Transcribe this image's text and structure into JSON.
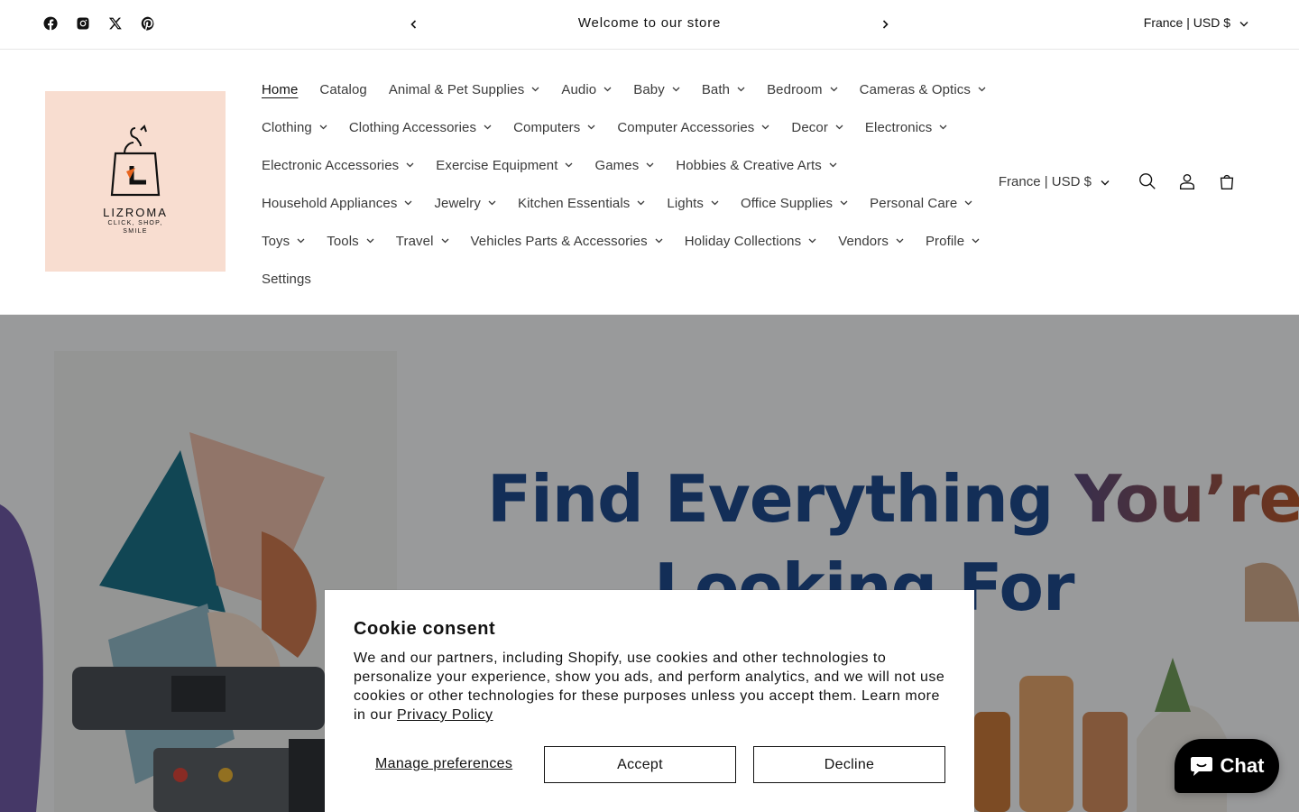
{
  "announcement": {
    "text": "Welcome to our store",
    "socials": [
      "facebook",
      "instagram",
      "x",
      "pinterest"
    ],
    "country_selector": "France | USD $"
  },
  "logo": {
    "name": "LIZROMA",
    "tagline": "CLICK, SHOP, SMILE"
  },
  "nav": {
    "rows": [
      [
        {
          "label": "Home",
          "dropdown": false,
          "active": true
        },
        {
          "label": "Catalog",
          "dropdown": false
        },
        {
          "label": "Animal & Pet Supplies",
          "dropdown": true
        },
        {
          "label": "Audio",
          "dropdown": true
        },
        {
          "label": "Baby",
          "dropdown": true
        },
        {
          "label": "Bath",
          "dropdown": true
        },
        {
          "label": "Bedroom",
          "dropdown": true
        },
        {
          "label": "Cameras & Optics",
          "dropdown": true
        }
      ],
      [
        {
          "label": "Clothing",
          "dropdown": true
        },
        {
          "label": "Clothing Accessories",
          "dropdown": true
        },
        {
          "label": "Computers",
          "dropdown": true
        },
        {
          "label": "Computer Accessories",
          "dropdown": true
        },
        {
          "label": "Decor",
          "dropdown": true
        },
        {
          "label": "Electronics",
          "dropdown": true
        }
      ],
      [
        {
          "label": "Electronic Accessories",
          "dropdown": true
        },
        {
          "label": "Exercise Equipment",
          "dropdown": true
        },
        {
          "label": "Games",
          "dropdown": true
        },
        {
          "label": "Hobbies & Creative Arts",
          "dropdown": true
        }
      ],
      [
        {
          "label": "Household Appliances",
          "dropdown": true
        },
        {
          "label": "Jewelry",
          "dropdown": true
        },
        {
          "label": "Kitchen Essentials",
          "dropdown": true
        },
        {
          "label": "Lights",
          "dropdown": true
        },
        {
          "label": "Office Supplies",
          "dropdown": true
        },
        {
          "label": "Personal Care",
          "dropdown": true
        }
      ],
      [
        {
          "label": "Toys",
          "dropdown": true
        },
        {
          "label": "Tools",
          "dropdown": true
        },
        {
          "label": "Travel",
          "dropdown": true
        },
        {
          "label": "Vehicles Parts & Accessories",
          "dropdown": true
        },
        {
          "label": "Holiday Collections",
          "dropdown": true
        },
        {
          "label": "Vendors",
          "dropdown": true
        },
        {
          "label": "Profile",
          "dropdown": true
        }
      ],
      [
        {
          "label": "Settings",
          "dropdown": false
        }
      ]
    ]
  },
  "header": {
    "country_selector": "France | USD $",
    "icons": [
      "search-icon",
      "account-icon",
      "cart-icon"
    ]
  },
  "hero": {
    "line1_a": "Find Everything ",
    "line1_b": "You’re",
    "line2": "Looking For"
  },
  "cookie": {
    "title": "Cookie consent",
    "body": "We and our partners, including Shopify, use cookies and other technologies to personalize your experience, show you ads, and perform analytics, and we will not use cookies or other technologies for these purposes unless you accept them. Learn more in our ",
    "link": "Privacy Policy",
    "manage": "Manage preferences",
    "accept": "Accept",
    "decline": "Decline"
  },
  "chat": {
    "label": "Chat"
  },
  "colors": {
    "logo_bg": "#f8ddd0",
    "hero_title": "#1f4a8a",
    "chat_bg": "#000000"
  }
}
